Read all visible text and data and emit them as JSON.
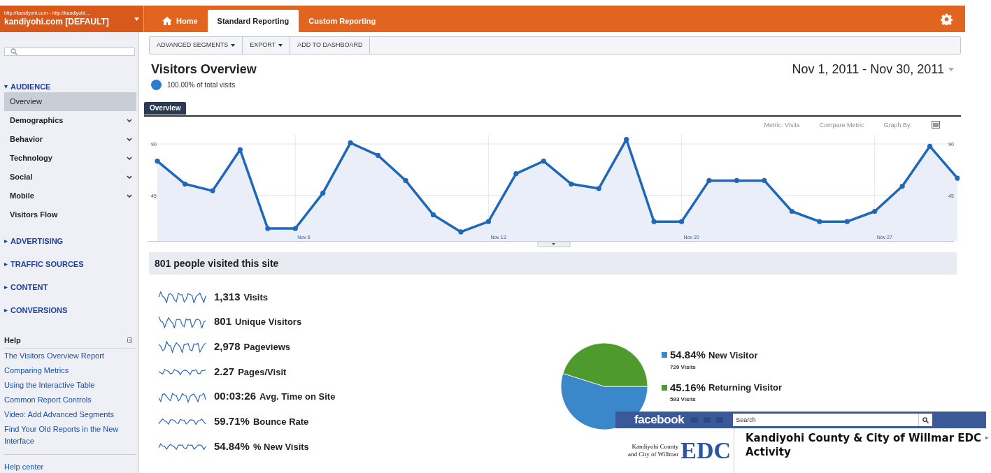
{
  "account": {
    "url": "http://kandiyohi.com - http://kandiyohi....",
    "name": "kandiyohi.com [DEFAULT]"
  },
  "nav_tabs": [
    {
      "label": "Home",
      "selected": false,
      "kind": "home"
    },
    {
      "label": "Standard Reporting",
      "selected": true,
      "kind": "plain"
    },
    {
      "label": "Custom Reporting",
      "selected": false,
      "kind": "plain"
    }
  ],
  "sidebar": {
    "sections": [
      {
        "label": "AUDIENCE",
        "expanded": true,
        "children": [
          {
            "label": "Overview",
            "selected": true,
            "expandable": false
          },
          {
            "label": "Demographics",
            "selected": false,
            "expandable": true
          },
          {
            "label": "Behavior",
            "selected": false,
            "expandable": true
          },
          {
            "label": "Technology",
            "selected": false,
            "expandable": true
          },
          {
            "label": "Social",
            "selected": false,
            "expandable": true
          },
          {
            "label": "Mobile",
            "selected": false,
            "expandable": true
          },
          {
            "label": "Visitors Flow",
            "selected": false,
            "expandable": false
          }
        ]
      },
      {
        "label": "ADVERTISING",
        "expanded": false
      },
      {
        "label": "TRAFFIC SOURCES",
        "expanded": false
      },
      {
        "label": "CONTENT",
        "expanded": false
      },
      {
        "label": "CONVERSIONS",
        "expanded": false
      }
    ],
    "help": {
      "title": "Help",
      "links": [
        "The Visitors Overview Report",
        "Comparing Metrics",
        "Using the Interactive Table",
        "Common Report Controls",
        "Video: Add Advanced Segments",
        "Find Your Old Reports in the New Interface"
      ],
      "footer": "Help center"
    }
  },
  "toolbar": [
    {
      "label": "ADVANCED SEGMENTS",
      "dropdown": true
    },
    {
      "label": "EXPORT",
      "dropdown": true
    },
    {
      "label": "ADD TO DASHBOARD",
      "dropdown": false
    }
  ],
  "report": {
    "title": "Visitors Overview",
    "segment": "100.00% of total visits",
    "date_range": "Nov 1, 2011 - Nov 30, 2011"
  },
  "graph_tab": {
    "label": "Overview",
    "selected": true
  },
  "graph_options": [
    "Metric: Visits",
    "Compare Metric",
    "Graph By:"
  ],
  "chart_data": {
    "type": "area",
    "categories": [
      null,
      null,
      null,
      null,
      null,
      "Nov 6",
      null,
      null,
      null,
      null,
      null,
      null,
      "Nov 13",
      null,
      null,
      null,
      null,
      null,
      null,
      "Nov 20",
      null,
      null,
      null,
      null,
      null,
      null,
      "Nov 27",
      null,
      null,
      null
    ],
    "series": [
      {
        "color": "#1f67b8",
        "values": [
          75,
          55,
          49,
          85,
          16,
          16,
          47,
          91,
          80,
          58,
          28,
          13,
          22,
          64,
          75,
          55,
          51,
          94,
          22,
          22,
          58,
          58,
          58,
          31,
          22,
          22,
          31,
          53,
          88,
          60
        ]
      }
    ],
    "ylim": [
      5,
      98
    ],
    "yticks": [
      {
        "value": 45,
        "label": "45"
      },
      {
        "value": 90,
        "label": "90"
      }
    ]
  },
  "summary": {
    "title": "801 people visited this site",
    "metrics": [
      {
        "value": "1,313",
        "label": "Visits"
      },
      {
        "value": "801",
        "label": "Unique Visitors"
      },
      {
        "value": "2,978",
        "label": "Pageviews"
      },
      {
        "value": "2.27",
        "label": "Pages/Visit"
      },
      {
        "value": "00:03:26",
        "label": "Avg. Time on Site"
      },
      {
        "value": "59.71%",
        "label": "Bounce Rate"
      },
      {
        "value": "54.84%",
        "label": "% New Visits"
      }
    ]
  },
  "visitor_type": {
    "chart_data": {
      "type": "pie",
      "categories": [
        "New Visitor",
        "Returning Visitor"
      ],
      "series": [
        {
          "values": [
            54.84,
            45.16
          ]
        }
      ]
    },
    "legend": [
      {
        "percent": "54.84%",
        "visits": "720 Visits",
        "color": "#3a88c9"
      },
      {
        "percent": "45.16%",
        "visits": "593 Visits",
        "color": "#4f9a2c"
      }
    ]
  },
  "facebook": {
    "logo": "facebook",
    "search": {
      "placeholder": "Search"
    },
    "page_logo": {
      "initials": "EDC",
      "line_1": "Kandiyohi County",
      "line_2": "and City of Willmar"
    },
    "page_title": "Kandiyohi County & City of Willmar EDC",
    "arrow": "▸",
    "subtitle": "Activity"
  }
}
